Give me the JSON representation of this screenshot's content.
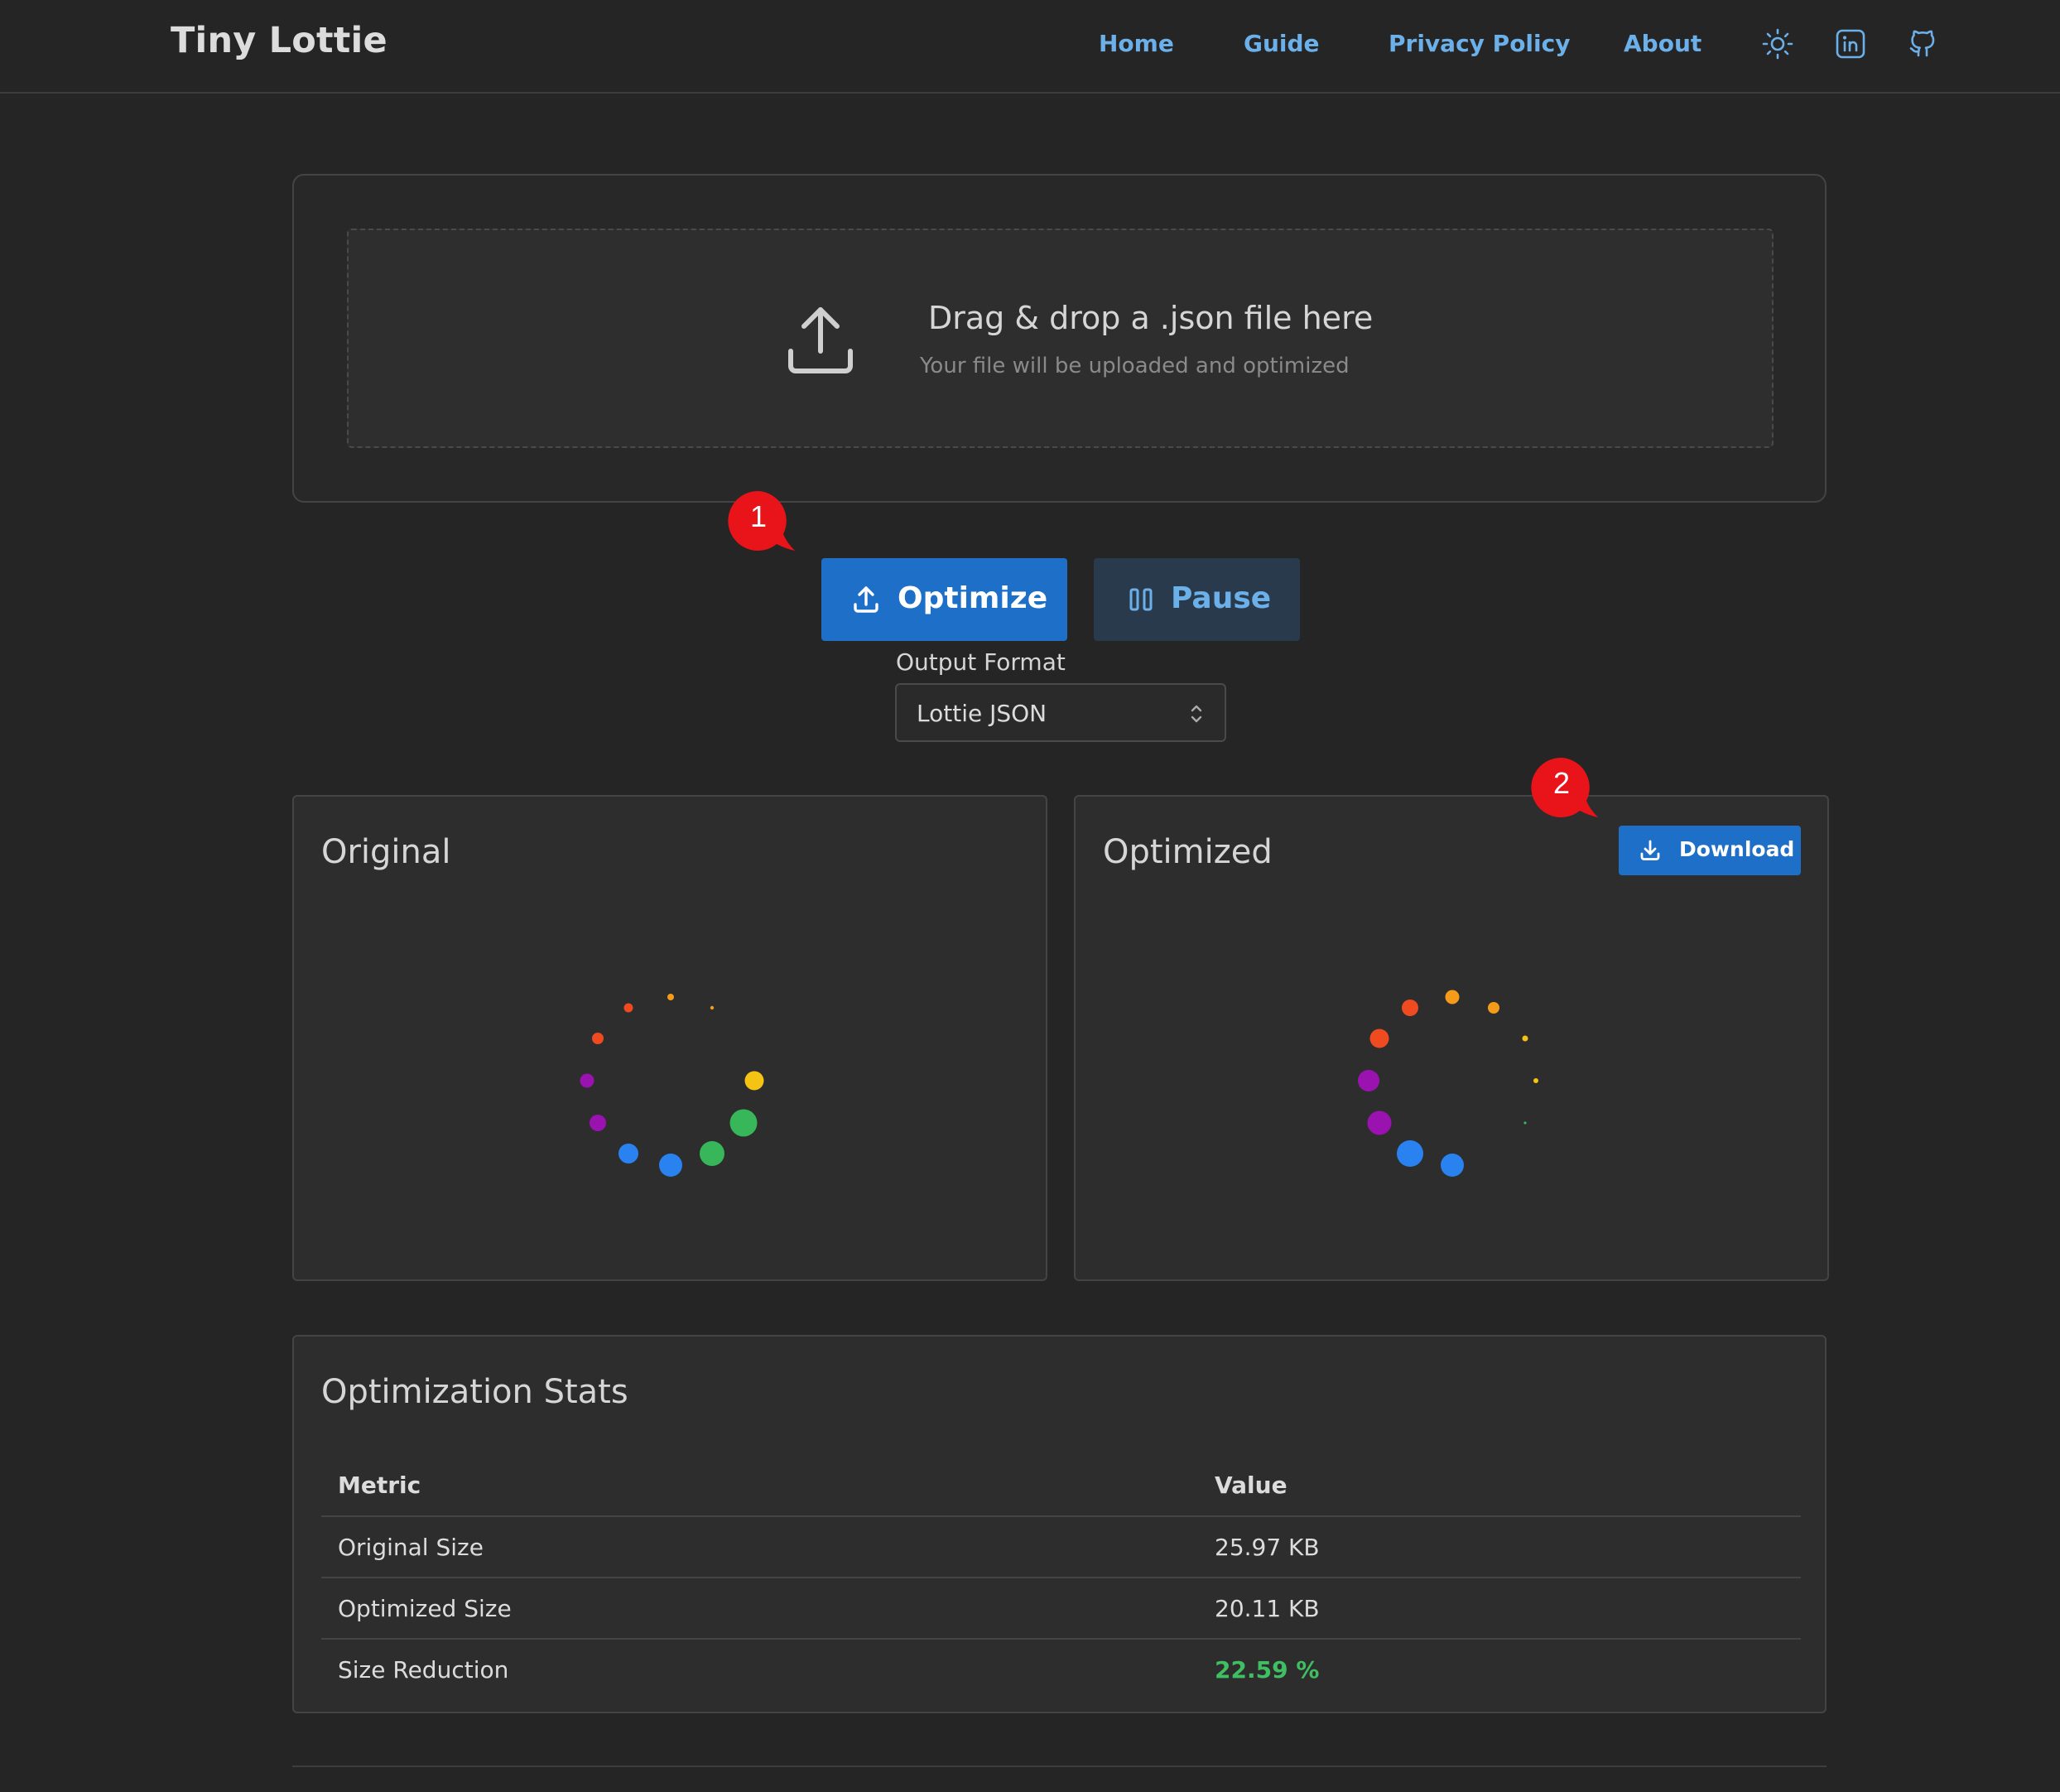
{
  "header": {
    "brand": "Tiny Lottie",
    "nav": [
      {
        "label": "Home"
      },
      {
        "label": "Guide"
      },
      {
        "label": "Privacy Policy"
      },
      {
        "label": "About"
      }
    ],
    "icons": [
      "sun-icon",
      "linkedin-icon",
      "github-icon"
    ]
  },
  "dropzone": {
    "title": "Drag & drop a .json file here",
    "subtitle": "Your file will be uploaded and optimized"
  },
  "markers": [
    "1",
    "2"
  ],
  "actions": {
    "optimize_label": "Optimize",
    "pause_label": "Pause"
  },
  "output": {
    "label": "Output Format",
    "selected": "Lottie JSON"
  },
  "panels": {
    "original_title": "Original",
    "optimized_title": "Optimized",
    "download_label": "Download"
  },
  "stats": {
    "title": "Optimization Stats",
    "headers": [
      "Metric",
      "Value"
    ],
    "rows": [
      {
        "metric": "Original Size",
        "value": "25.97 KB"
      },
      {
        "metric": "Optimized Size",
        "value": "20.11 KB"
      },
      {
        "metric": "Size Reduction",
        "value": "22.59 %"
      }
    ]
  },
  "colors": {
    "accent": "#1e6fc7",
    "link": "#6cb0ea",
    "success": "#3fbf61",
    "marker": "#e8141a"
  }
}
